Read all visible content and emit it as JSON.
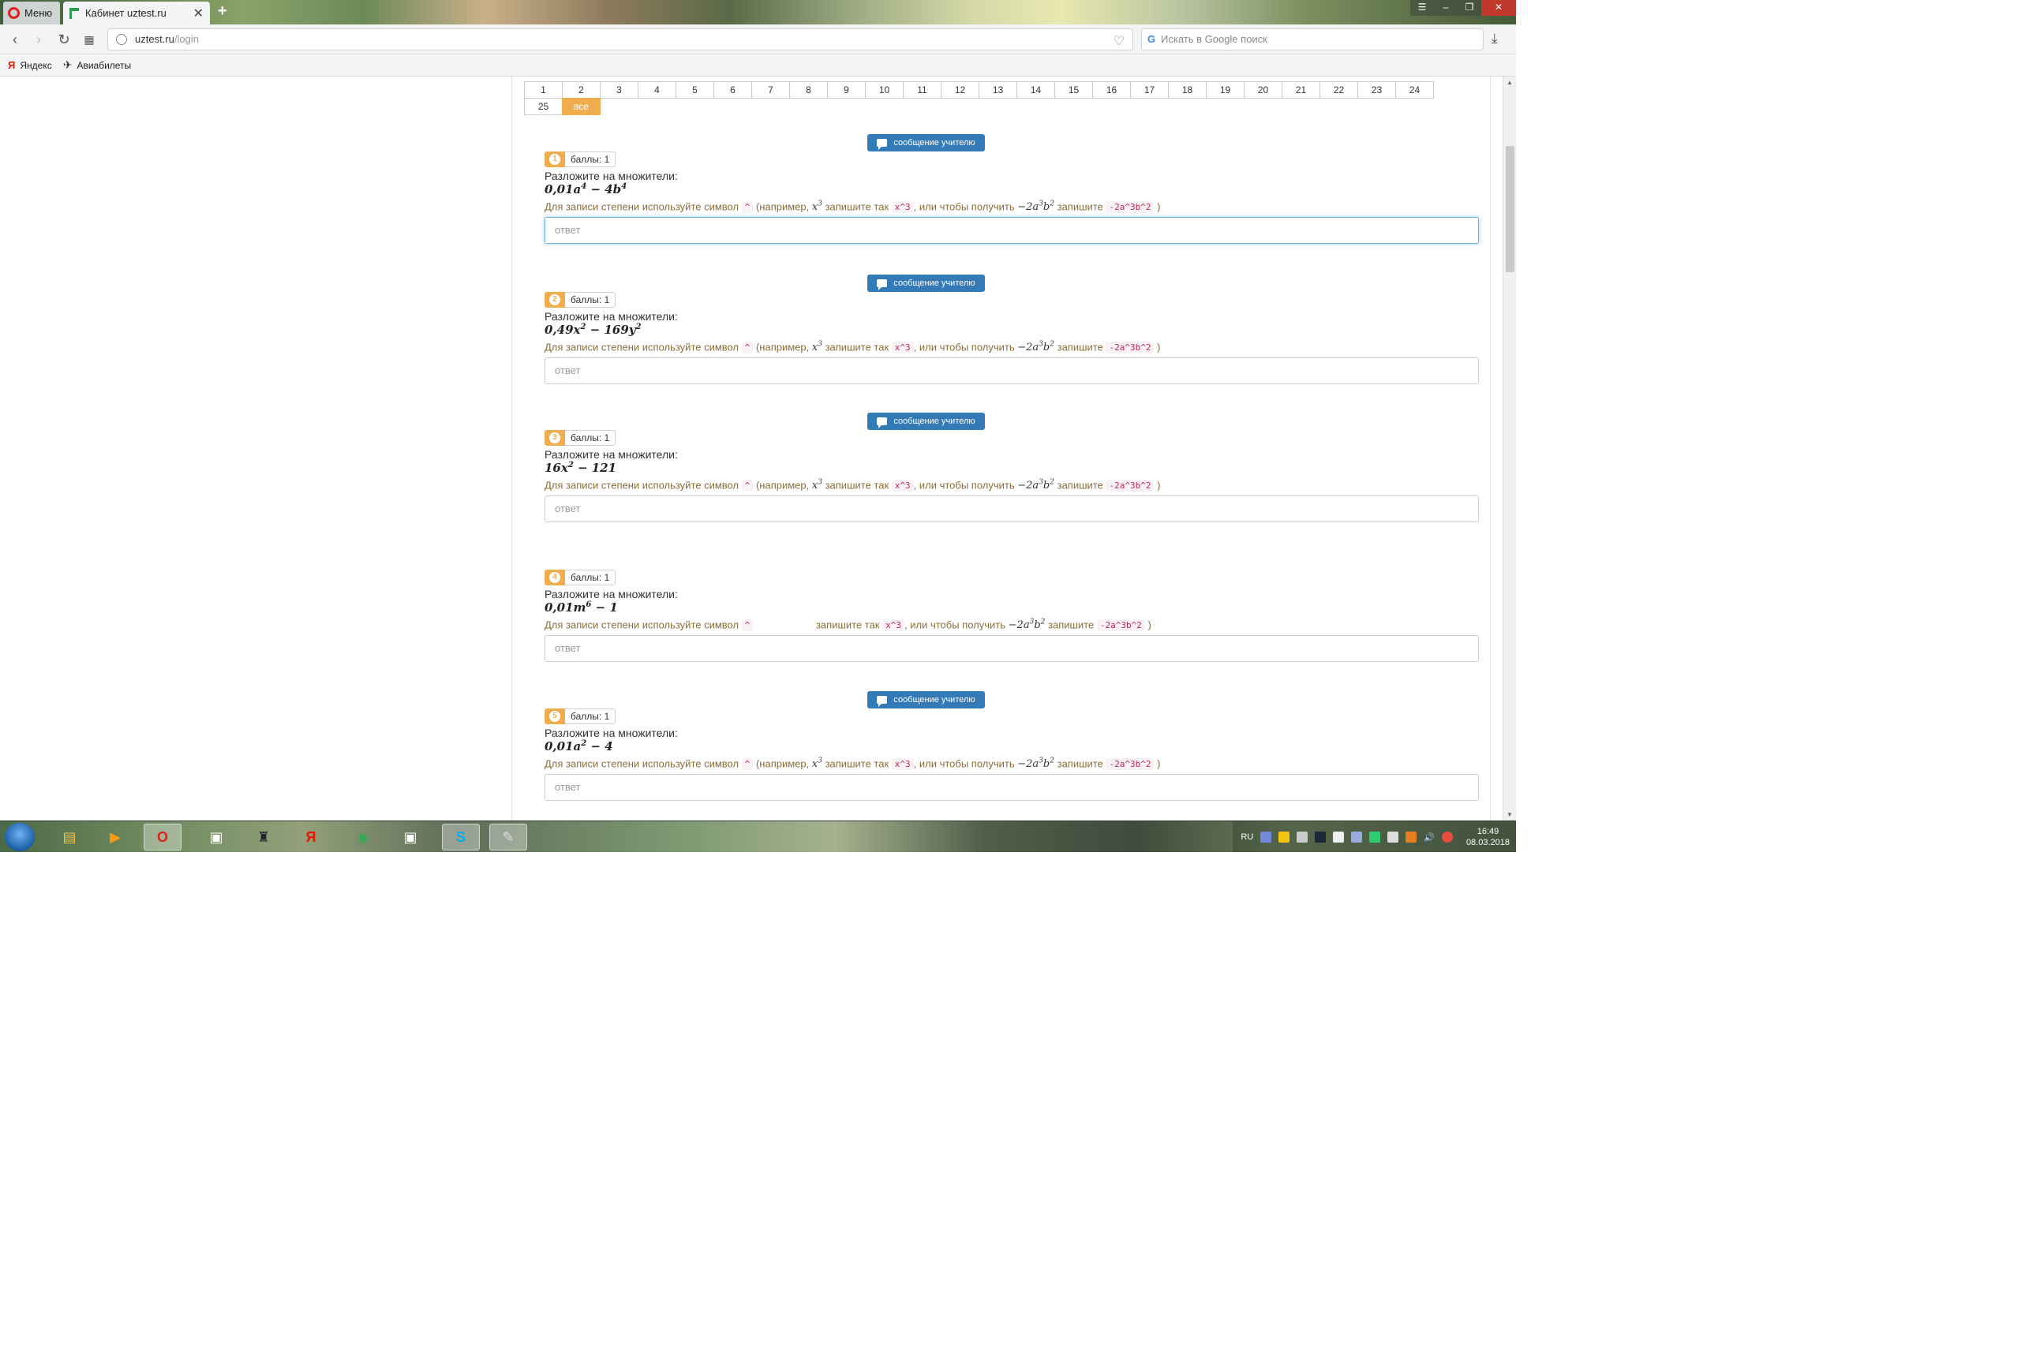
{
  "browser": {
    "menu_label": "Меню",
    "tab_title": "Кабинет uztest.ru",
    "url_host": "uztest.ru",
    "url_path": "/login",
    "search_placeholder": "Искать в Google поиск",
    "bookmarks": [
      "Яндекс",
      "Авиабилеты"
    ]
  },
  "pager": {
    "row1": [
      "1",
      "2",
      "3",
      "4",
      "5",
      "6",
      "7",
      "8",
      "9",
      "10",
      "11",
      "12",
      "13",
      "14",
      "15",
      "16",
      "17",
      "18",
      "19",
      "20",
      "21",
      "22",
      "23",
      "24"
    ],
    "row2": [
      "25",
      "все"
    ],
    "active_label": "все"
  },
  "common": {
    "message_button": "сообщение учителю",
    "prompt": "Разложите на множители:",
    "input_placeholder": "ответ",
    "hint_start": "Для записи степени используйте символ",
    "hint_caret": "^",
    "hint_example": "(например,",
    "hint_write_as": "запишите так",
    "hint_x3_code": "x^3",
    "hint_or": ", или чтобы получить",
    "hint_write": "запишите",
    "hint_code2": "-2a^3b^2",
    "hint_close": ")"
  },
  "questions": [
    {
      "num": "1",
      "score": "баллы: 1",
      "formula_html": "0,01a<sup>4</sup> − 4b<sup>4</sup>",
      "show_button": true,
      "focused": true
    },
    {
      "num": "2",
      "score": "баллы: 1",
      "formula_html": "0,49x<sup>2</sup> − 169y<sup>2</sup>",
      "show_button": true,
      "focused": false
    },
    {
      "num": "3",
      "score": "баллы: 1",
      "formula_html": "16x<sup>2</sup> − 121",
      "show_button": true,
      "focused": false
    },
    {
      "num": "4",
      "score": "баллы: 1",
      "formula_html": "0,01m<sup>6</sup> − 1",
      "show_button": false,
      "focused": false
    },
    {
      "num": "5",
      "score": "баллы: 1",
      "formula_html": "0,01a<sup>2</sup> − 4",
      "show_button": true,
      "focused": false
    }
  ],
  "taskbar": {
    "lang": "RU",
    "time": "16:49",
    "date": "08.03.2018"
  }
}
